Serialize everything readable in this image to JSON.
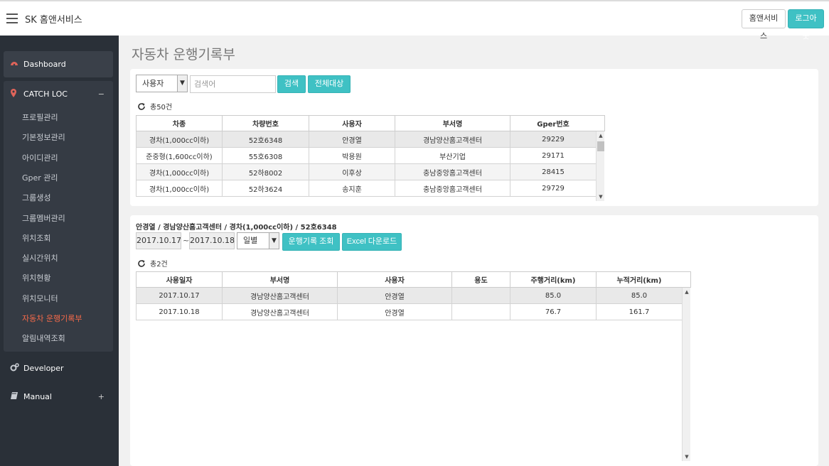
{
  "header": {
    "brand": "SK 홈앤서비스",
    "home_button": "홈앤서비스",
    "logout_button": "로그아웃"
  },
  "sidebar": {
    "dashboard": "Dashboard",
    "catch_loc": "CATCH LOC",
    "catch_sign": "−",
    "items": [
      "프로필관리",
      "기본정보관리",
      "아이디관리",
      "Gper 관리",
      "그룹생성",
      "그룹멤버관리",
      "위치조회",
      "실시간위치",
      "위치현황",
      "위치모니터",
      "자동차 운행기록부",
      "알림내역조회"
    ],
    "developer": "Developer",
    "manual": "Manual",
    "manual_sign": "+"
  },
  "page": {
    "title": "자동차 운행기록부"
  },
  "search": {
    "select_value": "사용자",
    "placeholder": "검색어",
    "search_button": "검색",
    "all_button": "전체대상",
    "count_label": "총50건"
  },
  "vehicles": {
    "columns": [
      "차종",
      "차량번호",
      "사용자",
      "부서명",
      "Gper번호"
    ],
    "rows": [
      [
        "경차(1,000cc이하)",
        "52호6348",
        "안경열",
        "경남양산홈고객센터",
        "29229"
      ],
      [
        "준중형(1,600cc이하)",
        "55호6308",
        "박용원",
        "부산기업",
        "29171"
      ],
      [
        "경차(1,000cc이하)",
        "52하8002",
        "이후상",
        "충남중앙홈고객센터",
        "28415"
      ],
      [
        "경차(1,000cc이하)",
        "52하3624",
        "송지훈",
        "충남중앙홈고객센터",
        "29729"
      ]
    ]
  },
  "detail": {
    "title": "안경열 / 경남양산홈고객센터 / 경차(1,000cc이하) / 52호6348",
    "date_from": "2017.10.17",
    "tilde": "~",
    "date_to": "2017.10.18",
    "period_value": "일별",
    "query_button": "운행기록 조회",
    "excel_button": "Excel 다운로드",
    "count_label": "총2건"
  },
  "logs": {
    "columns": [
      "사용일자",
      "부서명",
      "사용자",
      "용도",
      "주행거리(km)",
      "누적거리(km)"
    ],
    "rows": [
      [
        "2017.10.17",
        "경남양산홈고객센터",
        "안경열",
        "",
        "85.0",
        "85.0"
      ],
      [
        "2017.10.18",
        "경남양산홈고객센터",
        "안경열",
        "",
        "76.7",
        "161.7"
      ]
    ]
  },
  "colors": {
    "accent": "#3fc1c4",
    "sidebar_bg": "#2a3038",
    "active_menu": "#f56a4a"
  }
}
